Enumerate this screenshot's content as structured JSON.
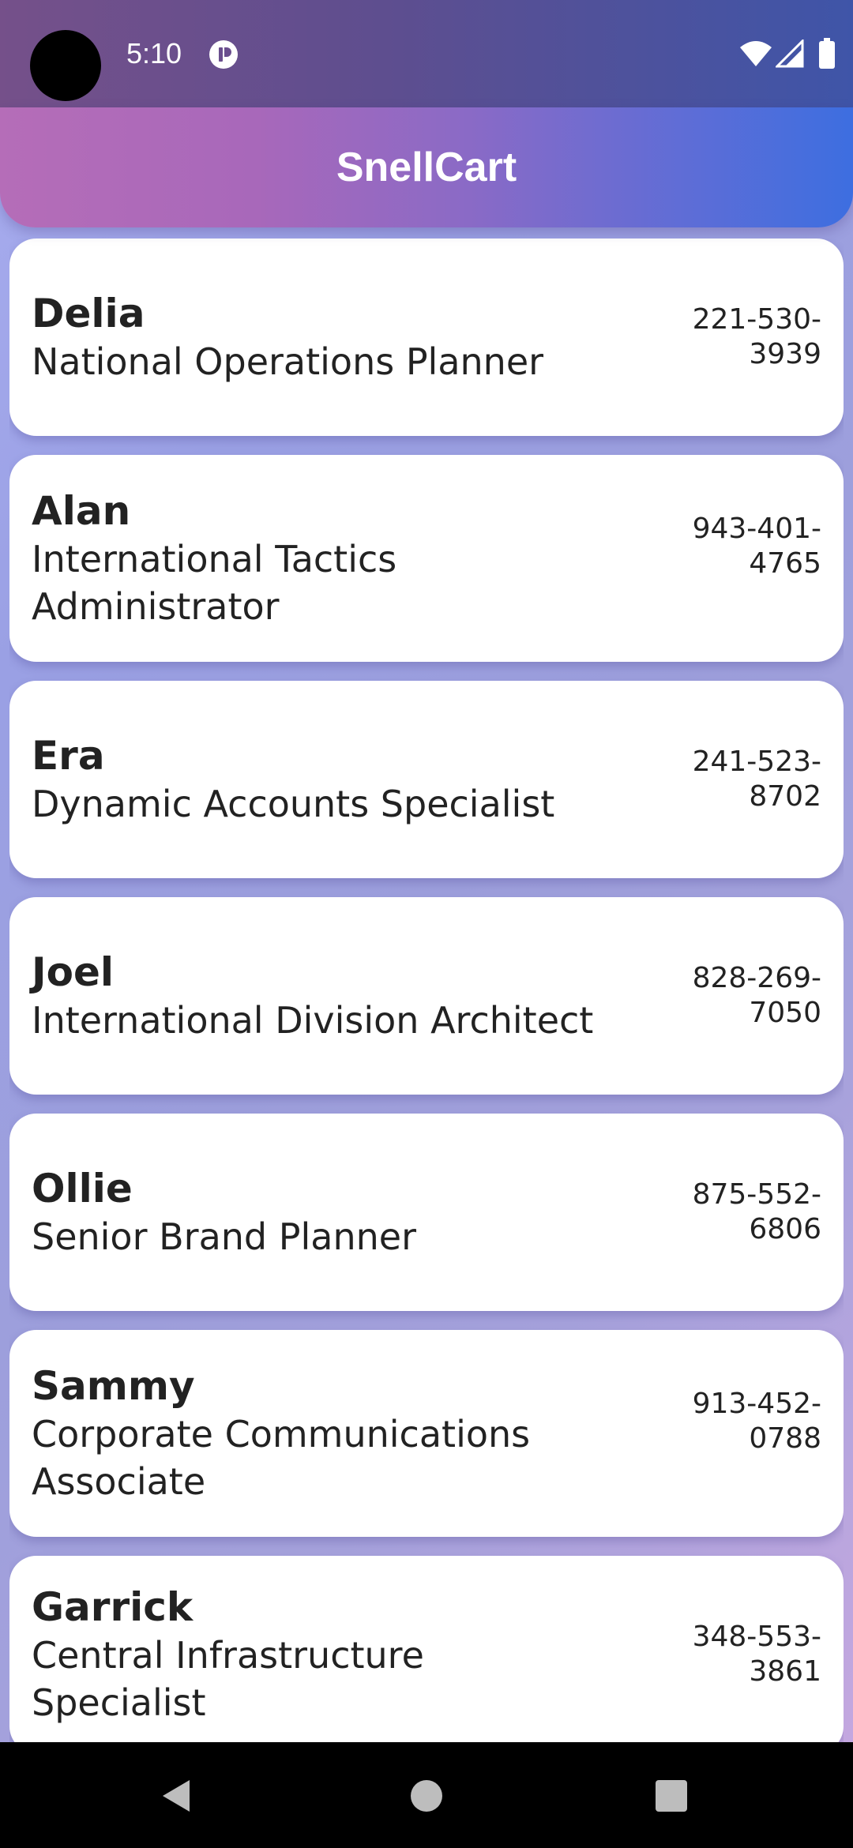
{
  "status_bar": {
    "time": "5:10",
    "icons": [
      "app-notification-icon",
      "wifi-icon",
      "cellular-signal-icon",
      "battery-icon"
    ]
  },
  "app_bar": {
    "title": "SnellCart"
  },
  "contacts": [
    {
      "name": "Delia",
      "role": "National Operations Planner",
      "phone": "221-530-3939"
    },
    {
      "name": "Alan",
      "role": "International Tactics Administrator",
      "phone": "943-401-4765"
    },
    {
      "name": "Era",
      "role": "Dynamic Accounts Specialist",
      "phone": "241-523-8702"
    },
    {
      "name": "Joel",
      "role": "International Division Architect",
      "phone": "828-269-7050"
    },
    {
      "name": "Ollie",
      "role": "Senior Brand Planner",
      "phone": "875-552-6806"
    },
    {
      "name": "Sammy",
      "role": "Corporate Communications Associate",
      "phone": "913-452-0788"
    },
    {
      "name": "Garrick",
      "role": "Central Infrastructure Specialist",
      "phone": "348-553-3861"
    }
  ],
  "nav_bar": {
    "icons": [
      "back-icon",
      "home-icon",
      "recent-apps-icon"
    ]
  },
  "colors": {
    "app_bar_start": "#b56db8",
    "app_bar_end": "#3d6ee0",
    "card_background": "#ffffff",
    "text": "#222222"
  }
}
